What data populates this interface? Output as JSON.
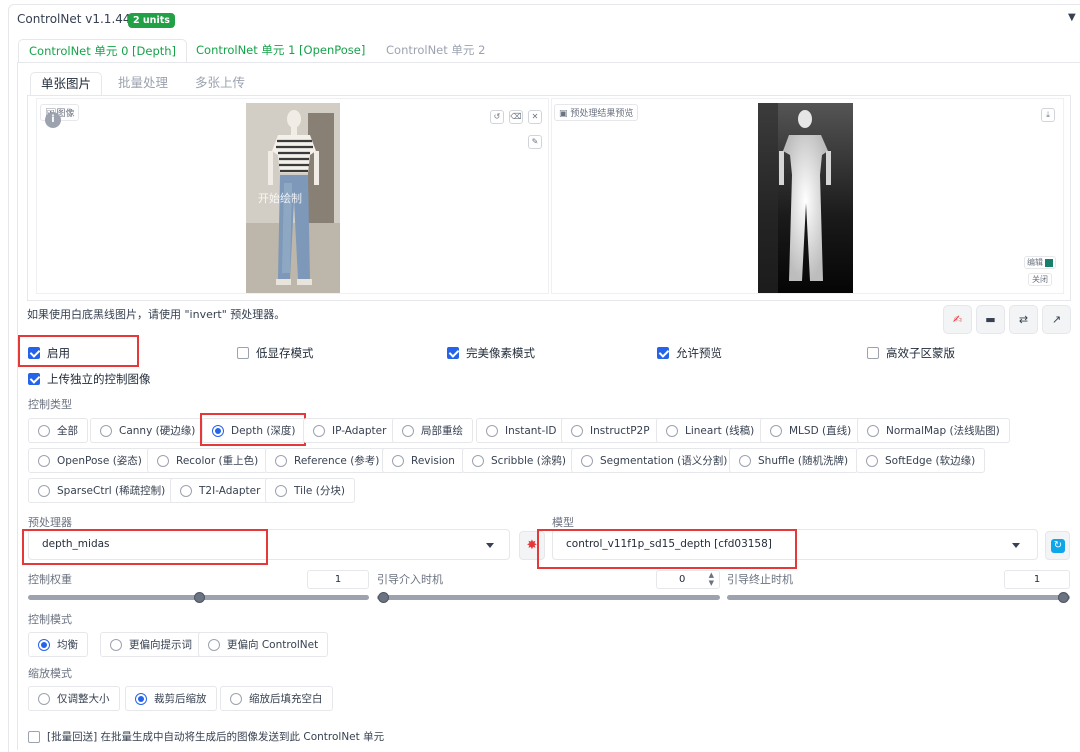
{
  "header": {
    "title": "ControlNet v1.1.449",
    "badge": "2 units"
  },
  "unit_tabs": [
    {
      "label": "ControlNet 单元 0 [Depth]"
    },
    {
      "label": "ControlNet 单元 1 [OpenPose]"
    },
    {
      "label": "ControlNet 单元 2"
    }
  ],
  "image_tabs": [
    {
      "label": "单张图片"
    },
    {
      "label": "批量处理"
    },
    {
      "label": "多张上传"
    }
  ],
  "image_panel": {
    "image_label": "图像",
    "draw_hint": "开始绘制",
    "preview_label": "预处理结果预览",
    "edit_label": "编辑",
    "close_label": "关闭"
  },
  "hint_text": "如果使用白底黑线图片，请使用 \"invert\" 预处理器。",
  "checkboxes": {
    "enable": "启用",
    "low_vram": "低显存模式",
    "pixel_perfect": "完美像素模式",
    "allow_preview": "允许预览",
    "efficient_mask": "高效子区蒙版",
    "upload_independent": "上传独立的控制图像"
  },
  "control_type": {
    "label": "控制类型",
    "options": [
      "全部",
      "Canny (硬边缘)",
      "Depth (深度)",
      "IP-Adapter",
      "局部重绘",
      "Instant-ID",
      "InstructP2P",
      "Lineart (线稿)",
      "MLSD (直线)",
      "NormalMap (法线贴图)",
      "OpenPose (姿态)",
      "Recolor (重上色)",
      "Reference (参考)",
      "Revision",
      "Scribble (涂鸦)",
      "Segmentation (语义分割)",
      "Shuffle (随机洗牌)",
      "SoftEdge (软边缘)",
      "SparseCtrl (稀疏控制)",
      "T2I-Adapter",
      "Tile (分块)"
    ],
    "selected": "Depth (深度)"
  },
  "preprocessor": {
    "label": "预处理器",
    "value": "depth_midas"
  },
  "model": {
    "label": "模型",
    "value": "control_v11f1p_sd15_depth [cfd03158]"
  },
  "sliders": {
    "weight": {
      "label": "控制权重",
      "value": "1",
      "fraction": 0.5
    },
    "start": {
      "label": "引导介入时机",
      "value": "0",
      "fraction": 0.0
    },
    "end": {
      "label": "引导终止时机",
      "value": "1",
      "fraction": 1.0
    }
  },
  "control_mode": {
    "label": "控制模式",
    "options": [
      "均衡",
      "更偏向提示词",
      "更偏向 ControlNet"
    ],
    "selected": "均衡"
  },
  "resize_mode": {
    "label": "缩放模式",
    "options": [
      "仅调整大小",
      "裁剪后缩放",
      "缩放后填充空白"
    ],
    "selected": "裁剪后缩放"
  },
  "batch_loopback": "[批量回送] 在批量生成中自动将生成后的图像发送到此 ControlNet 单元",
  "colors": {
    "accent": "#2563eb",
    "green": "#16a34a",
    "highlight_red": "#e53939"
  }
}
